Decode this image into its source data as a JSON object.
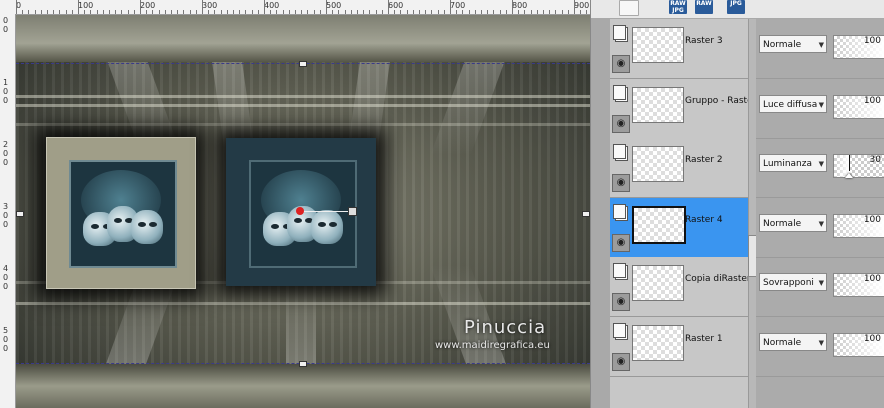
{
  "ruler": {
    "top_labels": [
      "0",
      "100",
      "200",
      "300",
      "400",
      "500",
      "600",
      "700",
      "800",
      "900"
    ],
    "left_labels": [
      {
        "lines": [
          "0",
          "0"
        ]
      },
      {
        "lines": [
          "1",
          "0",
          "0"
        ]
      },
      {
        "lines": [
          "2",
          "0",
          "0"
        ]
      },
      {
        "lines": [
          "3",
          "0",
          "0"
        ]
      },
      {
        "lines": [
          "4",
          "0",
          "0"
        ]
      },
      {
        "lines": [
          "5",
          "0",
          "0"
        ]
      }
    ]
  },
  "canvas": {
    "watermark_name": "Pinuccia",
    "watermark_url": "www.maidiregrafica.eu"
  },
  "toolbar": {
    "icons": [
      {
        "name": "share-icon",
        "label": ""
      },
      {
        "name": "document-icon",
        "label": ""
      },
      {
        "name": "raw-jpg-icon",
        "label": "RAW JPG"
      },
      {
        "name": "raw-icon",
        "label": "RAW"
      },
      {
        "name": "jpg-icon",
        "label": "JPG"
      }
    ]
  },
  "layers": [
    {
      "name": "Raster 3",
      "blend": "Normale",
      "opacity": "100",
      "opacity_fraction": 1.0,
      "selected": false
    },
    {
      "name": "Gruppo - Raster",
      "blend": "Luce diffusa",
      "opacity": "100",
      "opacity_fraction": 1.0,
      "selected": false
    },
    {
      "name": "Raster 2",
      "blend": "Luminanza",
      "opacity": "30",
      "opacity_fraction": 0.3,
      "selected": false
    },
    {
      "name": "Raster 4",
      "blend": "Normale",
      "opacity": "100",
      "opacity_fraction": 1.0,
      "selected": true
    },
    {
      "name": "Copia diRaster",
      "blend": "Sovrapponi",
      "opacity": "100",
      "opacity_fraction": 1.0,
      "selected": false
    },
    {
      "name": "Raster 1",
      "blend": "Normale",
      "opacity": "100",
      "opacity_fraction": 1.0,
      "selected": false
    }
  ],
  "colors": {
    "selection": "#3a95f0",
    "panel_bg": "#a9a9a9"
  }
}
